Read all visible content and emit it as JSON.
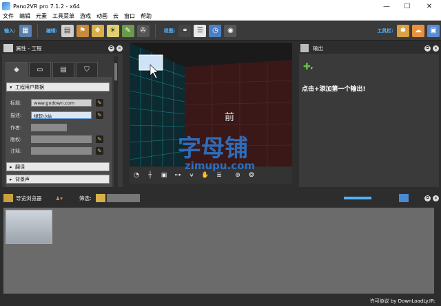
{
  "window": {
    "title": "Pano2VR pro 7.1.2 - x64",
    "min": "—",
    "max": "☐",
    "close": "✕"
  },
  "menu": [
    "文件",
    "编辑",
    "元素",
    "工具菜单",
    "游戏",
    "动画",
    "云",
    "窗口",
    "帮助"
  ],
  "toolbar": {
    "input_label": "输入:",
    "edit_label": "编辑:",
    "view_label": "视图:",
    "toolbar_label": "工具栏:"
  },
  "left_panel": {
    "title": "属性 - 工程",
    "section_user": "工程用户数据",
    "fields": [
      {
        "label": "标题:",
        "value": "www.gndown.com"
      },
      {
        "label": "描述:",
        "value": "绿软小站"
      },
      {
        "label": "作者:",
        "value": ""
      },
      {
        "label": "版权:",
        "value": ""
      },
      {
        "label": "注释:",
        "value": ""
      }
    ],
    "section_translate": "翻译",
    "section_bgsound": "背景声"
  },
  "viewer": {
    "face_label": "前"
  },
  "right_panel": {
    "title": "输出",
    "hint": "点击+添加第一个输出!"
  },
  "bottom_panel": {
    "title": "导览浏览器",
    "filter_label": "筛选:"
  },
  "status": {
    "license": "许可协议 by DownLoadLy.IR:"
  },
  "watermark": {
    "cn": "字母铺",
    "en": "zimupu.com"
  },
  "colors": {
    "accent": "#4fb3ff",
    "panel": "#3a3a3a",
    "grid": "#1fa7a7",
    "wall": "#3a1818"
  }
}
